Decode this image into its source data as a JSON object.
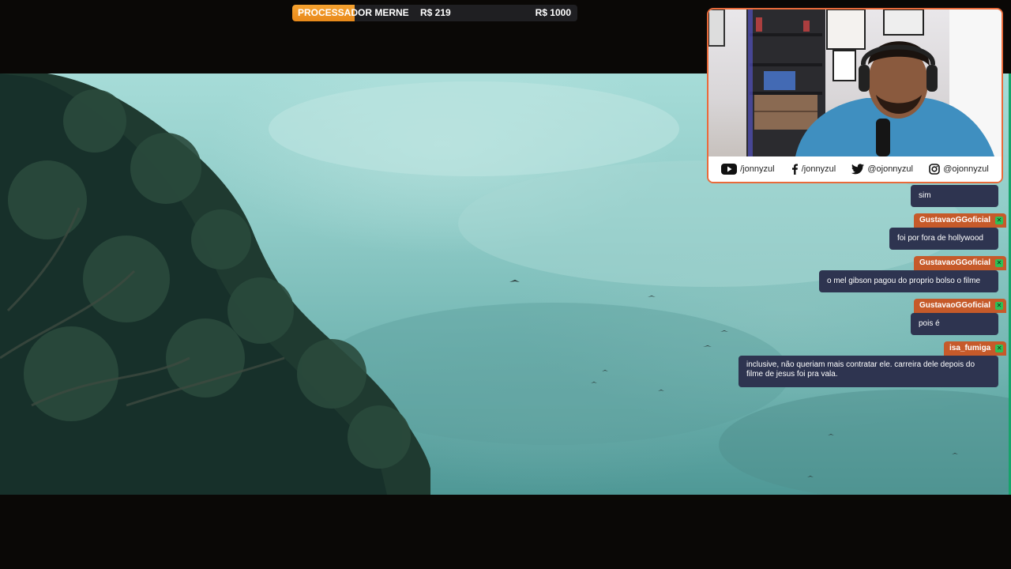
{
  "goal": {
    "title": "PROCESSADOR MERNE",
    "current": "R$ 219",
    "target": "R$ 1000",
    "progress": 0.219,
    "accent": "#f5a230"
  },
  "webcam": {
    "border_color": "#e96a3a",
    "socials": [
      {
        "icon": "youtube-icon",
        "handle": "/jonnyzul"
      },
      {
        "icon": "facebook-icon",
        "handle": "/jonnyzul"
      },
      {
        "icon": "twitter-icon",
        "handle": "@ojonnyzul"
      },
      {
        "icon": "instagram-icon",
        "handle": "@ojonnyzul"
      }
    ]
  },
  "chat": {
    "badge_icon": "x-badge-icon",
    "messages": [
      {
        "user": "",
        "text": "sim"
      },
      {
        "user": "GustavaoGGoficial",
        "text": "foi por fora de hollywood"
      },
      {
        "user": "GustavaoGGoficial",
        "text": "o mel gibson pagou do proprio bolso o filme"
      },
      {
        "user": "GustavaoGGoficial",
        "text": "pois é"
      },
      {
        "user": "isa_fumiga",
        "text": "inclusive, não queriam mais contratar ele. carreira dele depois do filme de jesus foi pra vala."
      }
    ]
  }
}
